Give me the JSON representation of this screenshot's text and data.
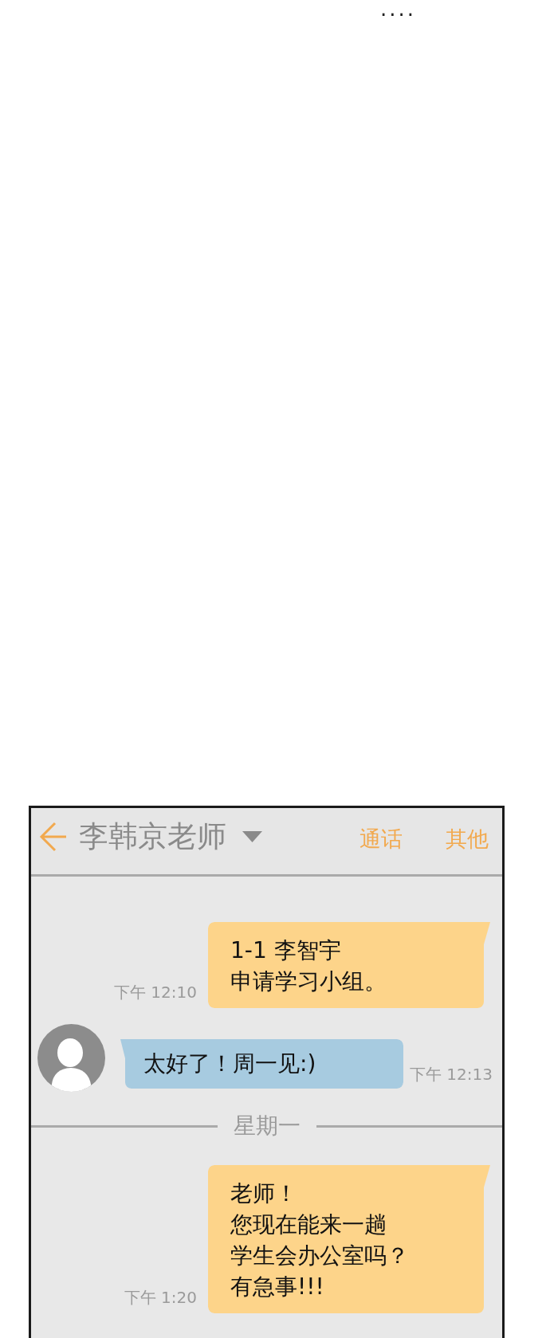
{
  "caption": {
    "text": "...."
  },
  "chat_header": {
    "title": "李韩京老师",
    "actions": [
      "通话",
      "其他"
    ]
  },
  "messages": [
    {
      "kind": "outgoing",
      "lines": [
        "1-1 李智宇",
        "申请学习小组。"
      ],
      "time": "下午 12:10"
    },
    {
      "kind": "incoming",
      "lines": [
        "太好了！周一见:)"
      ],
      "time": "下午 12:13"
    },
    {
      "kind": "date_divider",
      "text": "星期一"
    },
    {
      "kind": "outgoing",
      "lines": [
        "老师！",
        "您现在能来一趟",
        "学生会办公室吗？",
        "有急事!!!"
      ],
      "time": "下午 1:20"
    }
  ]
}
